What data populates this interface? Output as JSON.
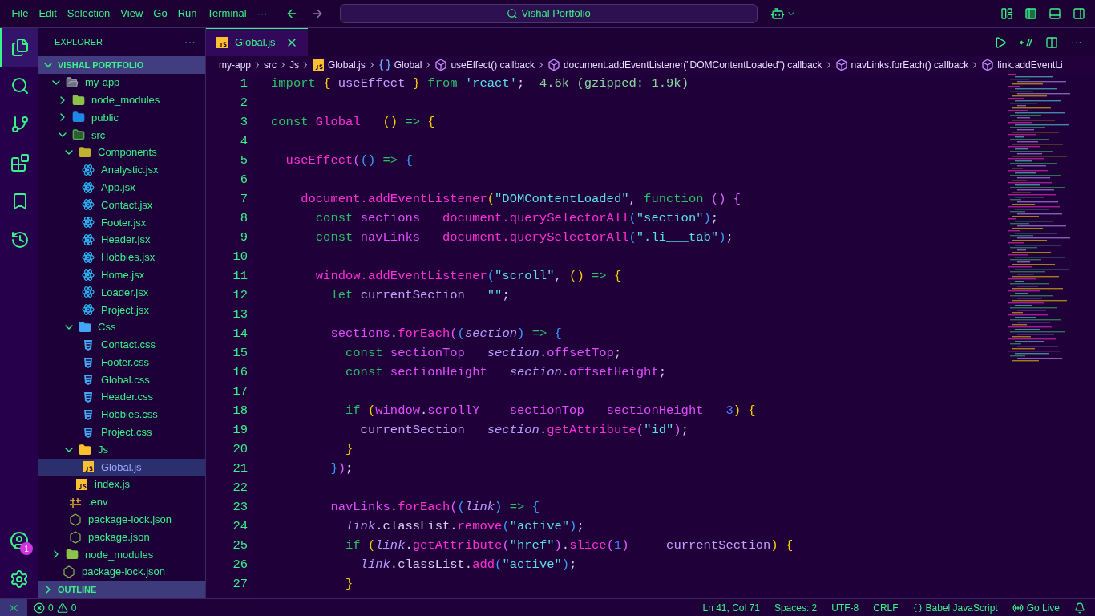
{
  "menu": [
    "File",
    "Edit",
    "Selection",
    "View",
    "Go",
    "Run",
    "Terminal",
    "···"
  ],
  "search": {
    "value": "Vishal Portfolio"
  },
  "activity": [
    {
      "kind": "files",
      "selected": true
    },
    {
      "kind": "search",
      "selected": false
    },
    {
      "kind": "git",
      "selected": false
    },
    {
      "kind": "extensions",
      "selected": false
    },
    {
      "kind": "bookmark",
      "selected": false
    },
    {
      "kind": "history",
      "selected": false
    }
  ],
  "account": {
    "badge": "1"
  },
  "explorer": {
    "title": "EXPLORER",
    "more": "···",
    "root": "VISHAL PORTFOLIO",
    "outline": "OUTLINE",
    "tree": [
      {
        "name": "my-app",
        "kind": "folder",
        "expanded": true,
        "selected": false,
        "children": [
          {
            "name": "node_modules",
            "kind": "folder-node",
            "expanded": false,
            "selected": false
          },
          {
            "name": "public",
            "kind": "folder-public",
            "expanded": false,
            "selected": false
          },
          {
            "name": "src",
            "kind": "folder-src",
            "expanded": true,
            "selected": false,
            "children": [
              {
                "name": "Components",
                "kind": "folder-components",
                "expanded": true,
                "selected": false,
                "children": [
                  {
                    "name": "Analystic.jsx",
                    "kind": "react",
                    "selected": false
                  },
                  {
                    "name": "App.jsx",
                    "kind": "react",
                    "selected": false
                  },
                  {
                    "name": "Contact.jsx",
                    "kind": "react",
                    "selected": false
                  },
                  {
                    "name": "Footer.jsx",
                    "kind": "react",
                    "selected": false
                  },
                  {
                    "name": "Header.jsx",
                    "kind": "react",
                    "selected": false
                  },
                  {
                    "name": "Hobbies.jsx",
                    "kind": "react",
                    "selected": false
                  },
                  {
                    "name": "Home.jsx",
                    "kind": "react",
                    "selected": false
                  },
                  {
                    "name": "Loader.jsx",
                    "kind": "react",
                    "selected": false
                  },
                  {
                    "name": "Project.jsx",
                    "kind": "react",
                    "selected": false
                  }
                ]
              },
              {
                "name": "Css",
                "kind": "folder-css",
                "expanded": true,
                "selected": false,
                "children": [
                  {
                    "name": "Contact.css",
                    "kind": "css",
                    "selected": false
                  },
                  {
                    "name": "Footer.css",
                    "kind": "css",
                    "selected": false
                  },
                  {
                    "name": "Global.css",
                    "kind": "css",
                    "selected": false
                  },
                  {
                    "name": "Header.css",
                    "kind": "css",
                    "selected": false
                  },
                  {
                    "name": "Hobbies.css",
                    "kind": "css",
                    "selected": false
                  },
                  {
                    "name": "Project.css",
                    "kind": "css",
                    "selected": false
                  }
                ]
              },
              {
                "name": "Js",
                "kind": "folder-js",
                "expanded": true,
                "selected": false,
                "children": [
                  {
                    "name": "Global.js",
                    "kind": "js",
                    "selected": true
                  }
                ]
              },
              {
                "name": "index.js",
                "kind": "js",
                "selected": false
              }
            ]
          },
          {
            "name": ".env",
            "kind": "env",
            "selected": false
          },
          {
            "name": "package-lock.json",
            "kind": "json",
            "selected": false
          },
          {
            "name": "package.json",
            "kind": "json",
            "selected": false
          }
        ]
      },
      {
        "name": "node_modules",
        "kind": "folder-node",
        "expanded": false,
        "selected": false
      },
      {
        "name": "package-lock.json",
        "kind": "json",
        "selected": false
      }
    ]
  },
  "tabs": [
    {
      "label": "Global.js",
      "selected": true
    }
  ],
  "breadcrumbs": [
    {
      "label": "my-app",
      "kind": "folder"
    },
    {
      "label": "src",
      "kind": "folder"
    },
    {
      "label": "Js",
      "kind": "folder"
    },
    {
      "label": "Global.js",
      "kind": "js"
    },
    {
      "label": "Global",
      "kind": "variable"
    },
    {
      "label": "useEffect() callback",
      "kind": "method"
    },
    {
      "label": "document.addEventListener(\"DOMContentLoaded\") callback",
      "kind": "method"
    },
    {
      "label": "navLinks.forEach() callback",
      "kind": "method"
    },
    {
      "label": "link.addEventLi",
      "kind": "method"
    }
  ],
  "code": [
    {
      "number": "1",
      "tokens": [
        {
          "kind": "kw",
          "text": "import "
        },
        {
          "kind": "br",
          "text": "{ "
        },
        {
          "kind": "id",
          "text": "useEffect "
        },
        {
          "kind": "br",
          "text": "} "
        },
        {
          "kind": "kw",
          "text": "from "
        },
        {
          "kind": "str",
          "text": "'react'"
        },
        {
          "kind": "pl",
          "text": ";  "
        },
        {
          "kind": "hint",
          "text": "4.6k (gzipped: 1.9k)"
        }
      ]
    },
    {
      "number": "2"
    },
    {
      "number": "3",
      "tokens": [
        {
          "kind": "kw",
          "text": "const "
        },
        {
          "kind": "fn",
          "text": "Global   "
        },
        {
          "kind": "br",
          "text": "()"
        },
        {
          "kind": "op",
          "text": " => "
        },
        {
          "kind": "br",
          "text": "{"
        }
      ]
    },
    {
      "number": "4"
    },
    {
      "number": "5",
      "tokens": [
        {
          "kind": "fn",
          "text": "  useEffect"
        },
        {
          "kind": "pr",
          "text": "("
        },
        {
          "kind": "par",
          "text": "()"
        },
        {
          "kind": "op",
          "text": " => "
        },
        {
          "kind": "par",
          "text": "{"
        }
      ]
    },
    {
      "number": "6"
    },
    {
      "number": "7",
      "tokens": [
        {
          "kind": "fn",
          "text": "    document.addEventListener"
        },
        {
          "kind": "br",
          "text": "("
        },
        {
          "kind": "str",
          "text": "\"DOMContentLoaded\""
        },
        {
          "kind": "pl",
          "text": ", "
        },
        {
          "kind": "kw",
          "text": "function "
        },
        {
          "kind": "pr",
          "text": "() {"
        }
      ]
    },
    {
      "number": "8",
      "tokens": [
        {
          "kind": "kw",
          "text": "      const "
        },
        {
          "kind": "var",
          "text": "sections   "
        },
        {
          "kind": "fn",
          "text": "document.querySelectorAll"
        },
        {
          "kind": "par",
          "text": "("
        },
        {
          "kind": "str",
          "text": "\"section\""
        },
        {
          "kind": "par",
          "text": ")"
        },
        {
          "kind": "pl",
          "text": ";"
        }
      ]
    },
    {
      "number": "9",
      "tokens": [
        {
          "kind": "kw",
          "text": "      const "
        },
        {
          "kind": "var",
          "text": "navLinks   "
        },
        {
          "kind": "fn",
          "text": "document.querySelectorAll"
        },
        {
          "kind": "par",
          "text": "("
        },
        {
          "kind": "str",
          "text": "\".li___tab\""
        },
        {
          "kind": "par",
          "text": ")"
        },
        {
          "kind": "pl",
          "text": ";"
        }
      ]
    },
    {
      "number": "10"
    },
    {
      "number": "11",
      "tokens": [
        {
          "kind": "fn",
          "text": "      window.addEventListener"
        },
        {
          "kind": "par",
          "text": "("
        },
        {
          "kind": "str",
          "text": "\"scroll\""
        },
        {
          "kind": "pl",
          "text": ", "
        },
        {
          "kind": "br",
          "text": "()"
        },
        {
          "kind": "op",
          "text": " => "
        },
        {
          "kind": "br",
          "text": "{"
        }
      ]
    },
    {
      "number": "12",
      "tokens": [
        {
          "kind": "kw",
          "text": "        let "
        },
        {
          "kind": "id",
          "text": "currentSection   "
        },
        {
          "kind": "str",
          "text": "\"\""
        },
        {
          "kind": "pl",
          "text": ";"
        }
      ]
    },
    {
      "number": "13"
    },
    {
      "number": "14",
      "tokens": [
        {
          "kind": "var",
          "text": "        sections"
        },
        {
          "kind": "pl",
          "text": "."
        },
        {
          "kind": "fn",
          "text": "forEach"
        },
        {
          "kind": "pr",
          "text": "("
        },
        {
          "kind": "par",
          "text": "("
        },
        {
          "kind": "param",
          "text": "section"
        },
        {
          "kind": "par",
          "text": ")"
        },
        {
          "kind": "op",
          "text": " => "
        },
        {
          "kind": "par",
          "text": "{"
        }
      ]
    },
    {
      "number": "15",
      "tokens": [
        {
          "kind": "kw",
          "text": "          const "
        },
        {
          "kind": "var",
          "text": "sectionTop   "
        },
        {
          "kind": "param",
          "text": "section"
        },
        {
          "kind": "pl",
          "text": "."
        },
        {
          "kind": "var",
          "text": "offsetTop"
        },
        {
          "kind": "pl",
          "text": ";"
        }
      ]
    },
    {
      "number": "16",
      "tokens": [
        {
          "kind": "kw",
          "text": "          const "
        },
        {
          "kind": "var",
          "text": "sectionHeight   "
        },
        {
          "kind": "param",
          "text": "section"
        },
        {
          "kind": "pl",
          "text": "."
        },
        {
          "kind": "var",
          "text": "offsetHeight"
        },
        {
          "kind": "pl",
          "text": ";"
        }
      ]
    },
    {
      "number": "17"
    },
    {
      "number": "18",
      "tokens": [
        {
          "kind": "kw",
          "text": "          if "
        },
        {
          "kind": "br",
          "text": "("
        },
        {
          "kind": "var",
          "text": "window"
        },
        {
          "kind": "pl",
          "text": "."
        },
        {
          "kind": "var",
          "text": "scrollY    sectionTop   sectionHeight   "
        },
        {
          "kind": "num",
          "text": "3"
        },
        {
          "kind": "br",
          "text": ") {"
        }
      ]
    },
    {
      "number": "19",
      "tokens": [
        {
          "kind": "id",
          "text": "            currentSection   "
        },
        {
          "kind": "param",
          "text": "section"
        },
        {
          "kind": "pl",
          "text": "."
        },
        {
          "kind": "fn",
          "text": "getAttribute"
        },
        {
          "kind": "pr",
          "text": "("
        },
        {
          "kind": "str",
          "text": "\"id\""
        },
        {
          "kind": "pr",
          "text": ")"
        },
        {
          "kind": "pl",
          "text": ";"
        }
      ]
    },
    {
      "number": "20",
      "tokens": [
        {
          "kind": "br",
          "text": "          }"
        }
      ]
    },
    {
      "number": "21",
      "tokens": [
        {
          "kind": "par",
          "text": "        }"
        },
        {
          "kind": "pr",
          "text": ")"
        },
        {
          "kind": "pl",
          "text": ";"
        }
      ]
    },
    {
      "number": "22"
    },
    {
      "number": "23",
      "tokens": [
        {
          "kind": "var",
          "text": "        navLinks"
        },
        {
          "kind": "pl",
          "text": "."
        },
        {
          "kind": "fn",
          "text": "forEach"
        },
        {
          "kind": "pr",
          "text": "("
        },
        {
          "kind": "par",
          "text": "("
        },
        {
          "kind": "param",
          "text": "link"
        },
        {
          "kind": "par",
          "text": ")"
        },
        {
          "kind": "op",
          "text": " => "
        },
        {
          "kind": "par",
          "text": "{"
        }
      ]
    },
    {
      "number": "24",
      "tokens": [
        {
          "kind": "param",
          "text": "          link"
        },
        {
          "kind": "pl",
          "text": ".classList."
        },
        {
          "kind": "fn",
          "text": "remove"
        },
        {
          "kind": "par",
          "text": "("
        },
        {
          "kind": "str",
          "text": "\"active\""
        },
        {
          "kind": "par",
          "text": ")"
        },
        {
          "kind": "pl",
          "text": ";"
        }
      ]
    },
    {
      "number": "25",
      "tokens": [
        {
          "kind": "kw",
          "text": "          if "
        },
        {
          "kind": "br",
          "text": "("
        },
        {
          "kind": "param",
          "text": "link"
        },
        {
          "kind": "pl",
          "text": "."
        },
        {
          "kind": "fn",
          "text": "getAttribute"
        },
        {
          "kind": "pr",
          "text": "("
        },
        {
          "kind": "str",
          "text": "\"href\""
        },
        {
          "kind": "pr",
          "text": ")"
        },
        {
          "kind": "pl",
          "text": "."
        },
        {
          "kind": "fn",
          "text": "slice"
        },
        {
          "kind": "pr",
          "text": "("
        },
        {
          "kind": "num",
          "text": "1"
        },
        {
          "kind": "pr",
          "text": ")     "
        },
        {
          "kind": "id",
          "text": "currentSection"
        },
        {
          "kind": "br",
          "text": ") {"
        }
      ]
    },
    {
      "number": "26",
      "tokens": [
        {
          "kind": "param",
          "text": "            link"
        },
        {
          "kind": "pl",
          "text": ".classList."
        },
        {
          "kind": "fn",
          "text": "add"
        },
        {
          "kind": "par",
          "text": "("
        },
        {
          "kind": "str",
          "text": "\"active\""
        },
        {
          "kind": "par",
          "text": ")"
        },
        {
          "kind": "pl",
          "text": ";"
        }
      ]
    },
    {
      "number": "27",
      "tokens": [
        {
          "kind": "br",
          "text": "          }"
        }
      ]
    }
  ],
  "status": {
    "errors": "0",
    "warnings": "0",
    "right": [
      {
        "kind": "text",
        "label": "Ln 41, Col 71"
      },
      {
        "kind": "text",
        "label": "Spaces: 2"
      },
      {
        "kind": "text",
        "label": "UTF-8"
      },
      {
        "kind": "text",
        "label": "CRLF"
      },
      {
        "kind": "language",
        "label": "Babel JavaScript"
      },
      {
        "kind": "live",
        "label": "Go Live"
      }
    ]
  }
}
